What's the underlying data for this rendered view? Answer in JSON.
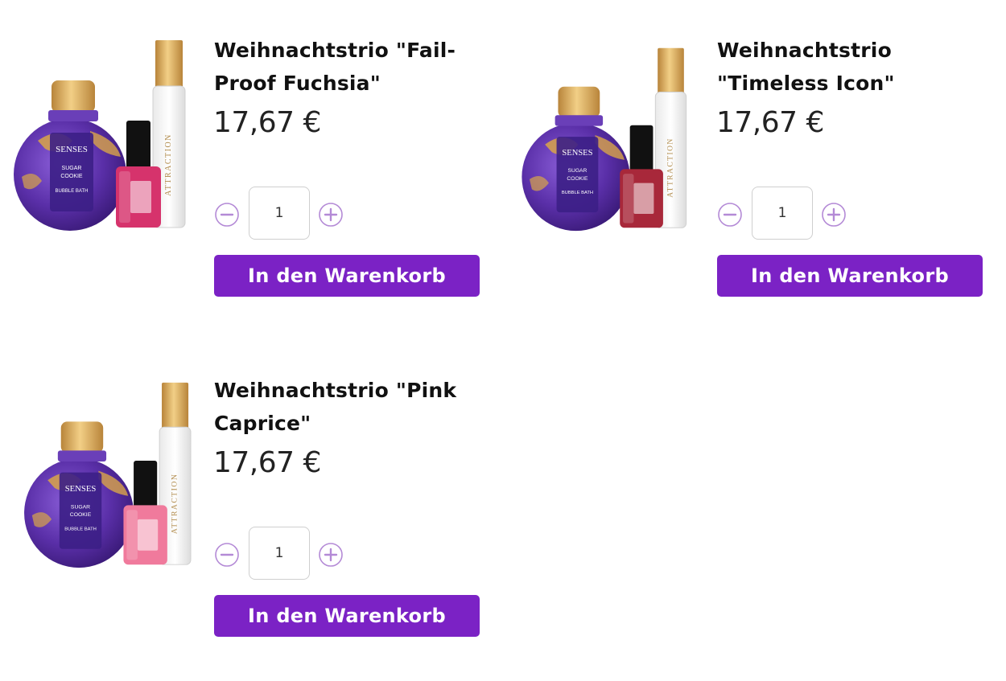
{
  "colors": {
    "accent": "#7b22c5",
    "qty_icon": "#b48ad6",
    "price_text": "#222222"
  },
  "products": [
    {
      "title_line1": "Weihnachtstrio \"Fail-",
      "title_line2": "Proof Fuchsia\"",
      "price": "17,67 €",
      "quantity": "1",
      "cart_label": "In den Warenkorb",
      "image": {
        "name": "fuchsia-gift-set-image",
        "bath_label": [
          "SENSES",
          "SUGAR",
          "COOKIE",
          "BUBBLE BATH"
        ],
        "perfume_label": "ATTRACTION",
        "polish_color": "#d6336c"
      }
    },
    {
      "title_line1": "Weihnachtstrio",
      "title_line2": "\"Timeless Icon\"",
      "price": "17,67 €",
      "quantity": "1",
      "cart_label": "In den Warenkorb",
      "image": {
        "name": "timeless-icon-gift-set-image",
        "bath_label": [
          "SENSES",
          "SUGAR",
          "COOKIE",
          "BUBBLE BATH"
        ],
        "perfume_label": "ATTRACTION",
        "polish_color": "#a8283a"
      }
    },
    {
      "title_line1": "Weihnachtstrio \"Pink",
      "title_line2": "Caprice\"",
      "price": "17,67 €",
      "quantity": "1",
      "cart_label": "In den Warenkorb",
      "image": {
        "name": "pink-caprice-gift-set-image",
        "bath_label": [
          "SENSES",
          "SUGAR",
          "COOKIE",
          "BUBBLE BATH"
        ],
        "perfume_label": "ATTRACTION",
        "polish_color": "#f07a9c"
      }
    }
  ]
}
